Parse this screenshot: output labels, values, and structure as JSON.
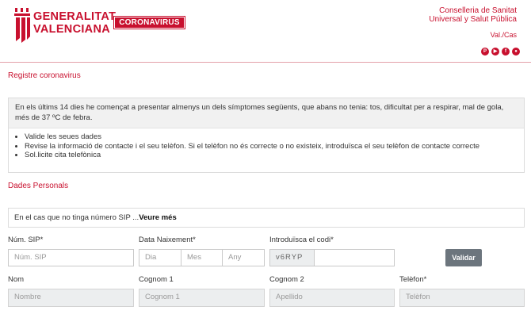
{
  "header": {
    "logo_line1": "GENERALITAT",
    "logo_line2": "VALENCIANA",
    "badge": "CORONAVIRUS",
    "dept_line1": "Conselleria de Sanitat",
    "dept_line2": "Universal y Salut Pública",
    "lang": "Val./Cas",
    "social": [
      {
        "icon": "pinterest-icon",
        "glyph": "P"
      },
      {
        "icon": "youtube-icon",
        "glyph": "▶"
      },
      {
        "icon": "facebook-icon",
        "glyph": "f"
      },
      {
        "icon": "flickr-icon",
        "glyph": "●"
      }
    ]
  },
  "colors": {
    "brand": "#c8102e",
    "button": "#6c757d"
  },
  "registre": {
    "title": "Registre coronavirus",
    "notice": "En els últims 14 dies he començat a presentar almenys un dels símptomes següents, que abans no tenia: tos, dificultat per a respirar, mal de gola, més de 37 ºC de febra.",
    "steps": [
      "Valide les seues dades",
      "Revise la informació de contacte i el seu telèfon. Si el telèfon no és correcte o no existeix, introduïsca el seu telèfon de contacte correcte",
      "Sol.licite cita telefònica"
    ]
  },
  "personal": {
    "title": "Dades Personals",
    "sip_note": "En el cas que no tinga número SIP ...",
    "sip_more": "Veure més",
    "sip_label": "Núm. SIP*",
    "sip_placeholder": "Núm. SIP",
    "birth_label": "Data Naixement*",
    "day_placeholder": "Dia",
    "month_placeholder": "Mes",
    "year_placeholder": "Any",
    "code_label": "Introduïsca el codi*",
    "captcha": "v6RYP",
    "validate_button": "Validar",
    "name_label": "Nom",
    "name_placeholder": "Nombre",
    "surname1_label": "Cognom 1",
    "surname1_placeholder": "Cognom 1",
    "surname2_label": "Cognom 2",
    "surname2_placeholder": "Apellido",
    "phone_label": "Telèfon*",
    "phone_placeholder": "Telèfon"
  }
}
